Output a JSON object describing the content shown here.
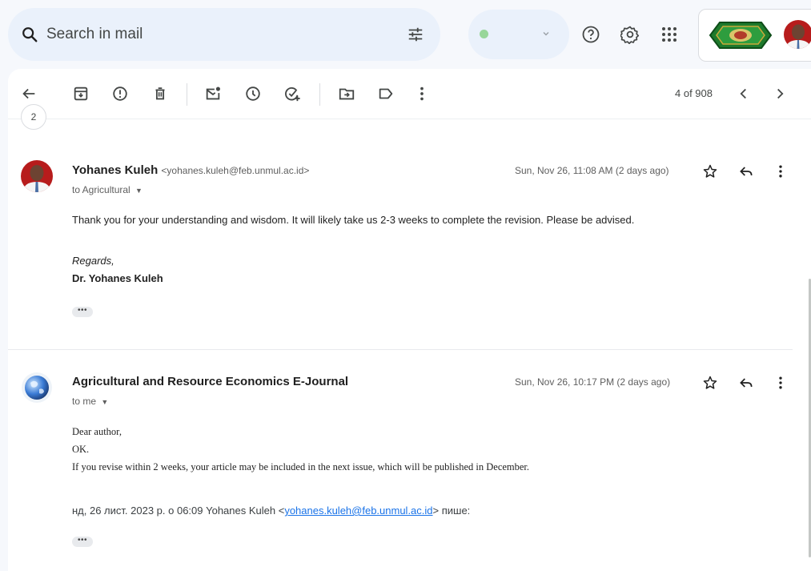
{
  "search": {
    "placeholder": "Search in mail"
  },
  "pagination": {
    "text": "4 of 908"
  },
  "previous_message": {
    "avatar_glyph": "2"
  },
  "messages": [
    {
      "sender_name": "Yohanes Kuleh",
      "sender_email": "<yohanes.kuleh@feb.unmul.ac.id>",
      "recipients": "to Agricultural",
      "date": "Sun, Nov 26, 11:08 AM (2 days ago)",
      "body": [
        "Thank you for your understanding and wisdom. It will likely take us 2-3 weeks to complete the revision. Please be advised."
      ],
      "signature_greeting": "Regards,",
      "signature_name": "Dr. Yohanes Kuleh",
      "trimmed_content": "•••"
    },
    {
      "sender_name": "Agricultural and Resource Economics E-Journal",
      "recipients": "to me",
      "date": "Sun, Nov 26, 10:17 PM (2 days ago)",
      "body": [
        "Dear author,",
        "OK.",
        "If you revise within 2 weeks, your article may be included in the next issue, which will be published in December."
      ],
      "quote_prefix": "нд, 26 лист. 2023 р. о 06:09 Yohanes Kuleh <",
      "quote_link": "yohanes.kuleh@feb.unmul.ac.id",
      "quote_suffix": "> пише:",
      "trimmed_content": "•••"
    }
  ],
  "colors": {
    "background": "#f6f8fc",
    "search_bg": "#eaf1fb",
    "status_dot": "#98d69a",
    "link": "#1a73e8"
  },
  "icons": [
    "search-icon",
    "tune-icon",
    "help-icon",
    "settings-icon",
    "apps-icon",
    "archive-icon",
    "report-spam-icon",
    "delete-icon",
    "mark-unread-icon",
    "snooze-icon",
    "add-to-tasks-icon",
    "move-to-icon",
    "label-icon",
    "more-vert-icon",
    "star-icon",
    "reply-icon",
    "back-arrow-icon",
    "chevron-left-icon",
    "chevron-right-icon"
  ]
}
